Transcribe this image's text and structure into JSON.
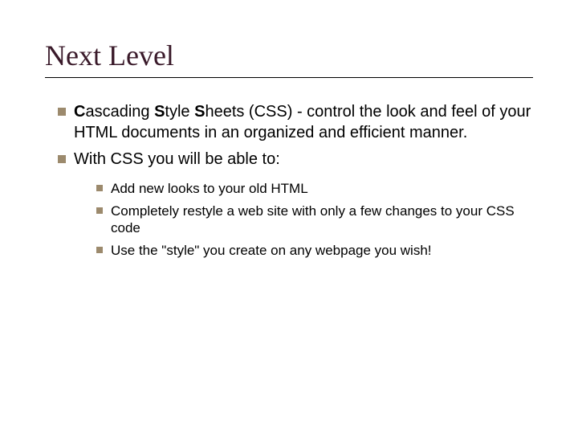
{
  "slide": {
    "title": "Next Level",
    "bullets": [
      {
        "lead_c": "C",
        "lead_rest1": "ascading ",
        "lead_s1": "S",
        "lead_rest2": "tyle ",
        "lead_s2": "S",
        "lead_rest3": "heets (CSS)",
        "tail": " - control the look and feel of your HTML documents in an organized and efficient manner."
      },
      {
        "text": "With CSS you will be able to:"
      }
    ],
    "sub_bullets": [
      "Add new looks to your old HTML",
      "Completely restyle a web site with only a few changes to your CSS code",
      "Use the \"style\" you create on any webpage you wish!"
    ]
  }
}
